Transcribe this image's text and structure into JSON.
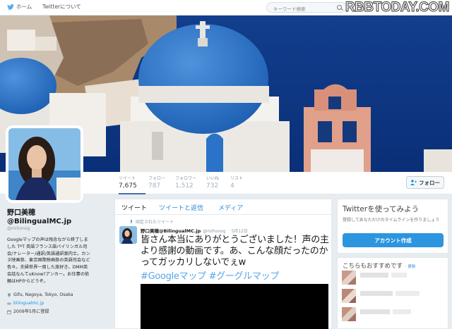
{
  "nav": {
    "home": "ホーム",
    "about": "Twitterについて",
    "search_placeholder": "キーワード検索",
    "right": "アカ",
    "watermark": "RBBTODAY.COM"
  },
  "stats": [
    {
      "label": "ツイート",
      "value": "7,675"
    },
    {
      "label": "フォロー",
      "value": "787"
    },
    {
      "label": "フォロワー",
      "value": "1,512"
    },
    {
      "label": "いいね",
      "value": "732"
    },
    {
      "label": "リスト",
      "value": "4"
    }
  ],
  "follow_button": "フォロー",
  "profile": {
    "name": "野口美穂",
    "handle_display": "@BilingualMC.jp",
    "handle": "@mihonog",
    "bio": "Googleマップの声は残念ながら終了しました T*T 英語フランス語バイリンガル司会/ナレーター/通訳/英語通訳案内士。カンヌ映画祭、東京国際映画祭の英語司会など色々。夫婦世界一周した旅好き。DMM英会話なんてuKnow?アンカー。お仕事の依頼はHPからどうぞ。",
    "location": "Gifu, Nagoya, Tokyo, Osaka",
    "url": "bilingualmc.jp",
    "joined": "2009年5月に登録"
  },
  "tabs": [
    "ツイート",
    "ツイートと返信",
    "メディア"
  ],
  "pinned_label": "固定されたツイート",
  "tweet": {
    "name": "野口美穂@BilingualMC.jp",
    "handle": "@mihonog",
    "date": "5月12日",
    "text": "皆さん本当にありがとうございました！声の主より感謝の動画です。あ、こんな顔だったのかってガッカリしないでぇw",
    "tags": "#Googleマップ #グーグルマップ"
  },
  "try_box": {
    "title": "Twitterを使ってみよう",
    "desc": "登録してあなただけのタイムラインを作りましょう",
    "button": "アカウント作成"
  },
  "recommend": {
    "title": "こちらもおすすめです",
    "update": "更新"
  }
}
